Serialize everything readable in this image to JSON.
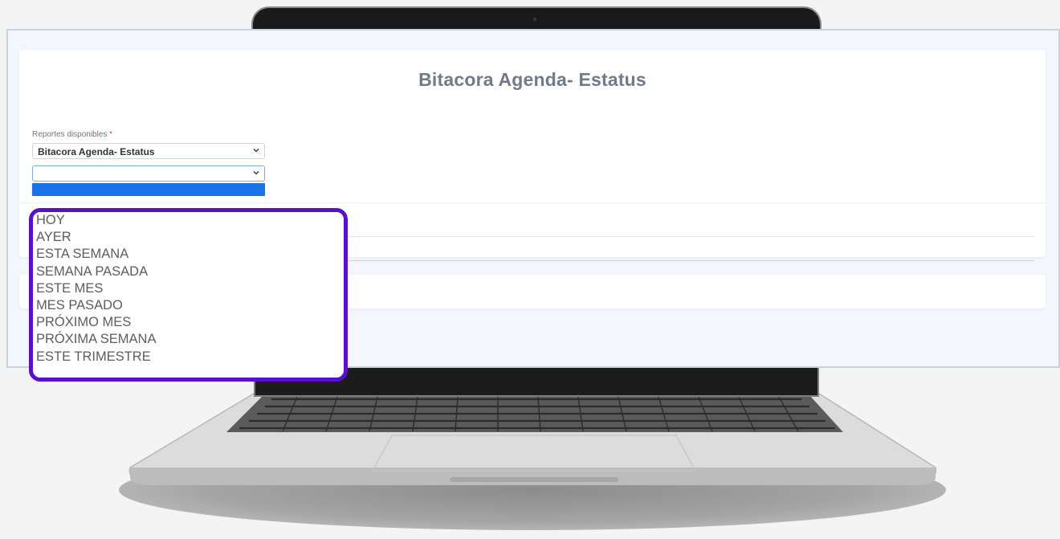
{
  "page": {
    "title": "Bitacora Agenda- Estatus"
  },
  "reports_field": {
    "label": "Reportes disponibles",
    "required_mark": "*",
    "selected_value": "Bitacora Agenda- Estatus"
  },
  "period_field": {
    "selected_value": ""
  },
  "period_options": [
    "HOY",
    "AYER",
    "ESTA SEMANA",
    "SEMANA PASADA",
    "ESTE MES",
    "MES PASADO",
    "PRÓXIMO MES",
    "PRÓXIMA SEMANA",
    "ESTE TRIMESTRE"
  ],
  "colors": {
    "dropdown_border": "#5a0fc8",
    "highlight": "#1a73e8",
    "title": "#6f7b8c"
  },
  "icons": [
    "chevron-down-icon",
    "camera-icon"
  ]
}
